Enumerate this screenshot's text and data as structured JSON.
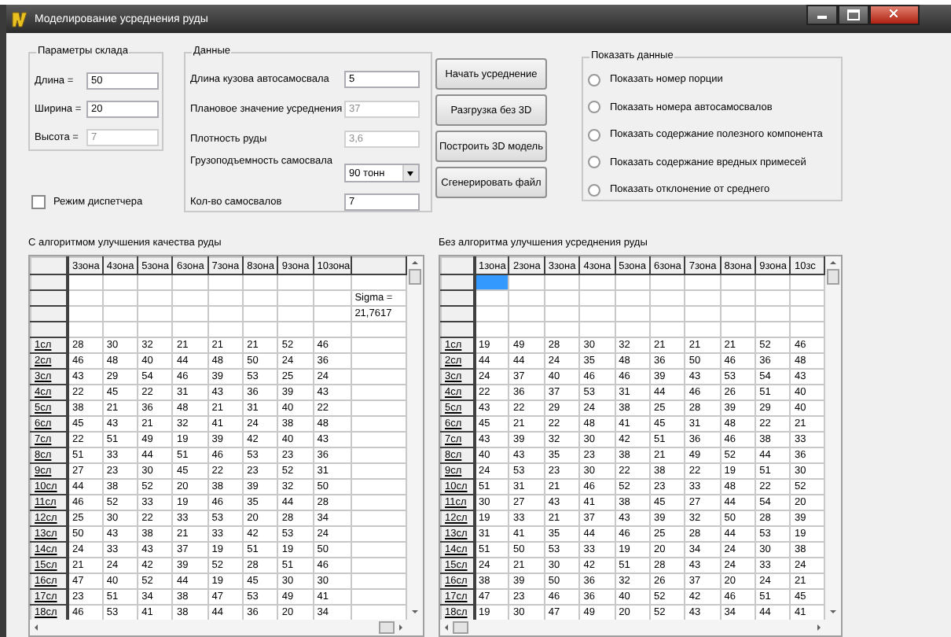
{
  "window": {
    "title": "Моделирование усреднения руды"
  },
  "warehouse": {
    "title": "Параметры склада",
    "fields": [
      {
        "label": "Длина =",
        "value": "50",
        "disabled": false
      },
      {
        "label": "Ширина =",
        "value": "20",
        "disabled": false
      },
      {
        "label": "Высота =",
        "value": "7",
        "disabled": true
      }
    ]
  },
  "dispatcher": {
    "label": "Режим диспетчера",
    "checked": false
  },
  "data": {
    "title": "Данные",
    "fields": [
      {
        "kind": "input",
        "label": "Длина кузова автосамосвала",
        "value": "5",
        "disabled": false
      },
      {
        "kind": "input",
        "label": "Плановое значение усреднения",
        "value": "37",
        "disabled": true
      },
      {
        "kind": "input",
        "label": "Плотность руды",
        "value": "3,6",
        "disabled": true
      },
      {
        "kind": "dropdown",
        "label": "Грузоподъемность самосвала",
        "value": "90 тонн"
      },
      {
        "kind": "input",
        "label": "Кол-во самосвалов",
        "value": "7",
        "disabled": false
      }
    ]
  },
  "buttons": [
    "Начать усреднение",
    "Разгрузка без 3D",
    "Построить 3D модель",
    "Сгенерировать файл"
  ],
  "show_data": {
    "title": "Показать данные",
    "options": [
      {
        "label": "Показать номер порции",
        "selected": false
      },
      {
        "label": "Показать номера автосамосвалов",
        "selected": false
      },
      {
        "label": "Показать содержание полезного компонента",
        "selected": false
      },
      {
        "label": "Показать содержание вредных примесей",
        "selected": false
      },
      {
        "label": "Показать отклонение от среднего",
        "selected": false
      }
    ]
  },
  "tables": [
    {
      "title": "С алгоритмом улучшения качества руды",
      "first_cell_selected": false,
      "columns": [
        "3зона",
        "4зона",
        "5зона",
        "6зона",
        "7зона",
        "8зона",
        "9зона",
        "10зона"
      ],
      "summary": [
        "Sigma =",
        "21,7617"
      ],
      "rows": [
        {
          "header": "1сл",
          "cells": [
            "28",
            "30",
            "32",
            "21",
            "21",
            "21",
            "52",
            "46"
          ]
        },
        {
          "header": "2сл",
          "cells": [
            "46",
            "48",
            "40",
            "44",
            "48",
            "50",
            "24",
            "36"
          ]
        },
        {
          "header": "3сл",
          "cells": [
            "43",
            "29",
            "54",
            "46",
            "39",
            "53",
            "25",
            "24"
          ]
        },
        {
          "header": "4сл",
          "cells": [
            "22",
            "45",
            "22",
            "31",
            "43",
            "36",
            "39",
            "43"
          ]
        },
        {
          "header": "5сл",
          "cells": [
            "38",
            "21",
            "36",
            "48",
            "21",
            "31",
            "40",
            "22"
          ]
        },
        {
          "header": "6сл",
          "cells": [
            "45",
            "43",
            "21",
            "32",
            "41",
            "24",
            "38",
            "48"
          ]
        },
        {
          "header": "7сл",
          "cells": [
            "22",
            "51",
            "49",
            "19",
            "39",
            "42",
            "40",
            "43"
          ]
        },
        {
          "header": "8сл",
          "cells": [
            "51",
            "33",
            "44",
            "51",
            "46",
            "53",
            "23",
            "36"
          ]
        },
        {
          "header": "9сл",
          "cells": [
            "27",
            "23",
            "30",
            "45",
            "22",
            "23",
            "52",
            "31"
          ]
        },
        {
          "header": "10сл",
          "cells": [
            "44",
            "38",
            "52",
            "20",
            "38",
            "39",
            "32",
            "50"
          ]
        },
        {
          "header": "11сл",
          "cells": [
            "46",
            "52",
            "33",
            "19",
            "46",
            "35",
            "44",
            "28"
          ]
        },
        {
          "header": "12сл",
          "cells": [
            "25",
            "30",
            "22",
            "33",
            "53",
            "20",
            "28",
            "34"
          ]
        },
        {
          "header": "13сл",
          "cells": [
            "50",
            "43",
            "38",
            "21",
            "33",
            "42",
            "53",
            "24"
          ]
        },
        {
          "header": "14сл",
          "cells": [
            "24",
            "33",
            "43",
            "37",
            "19",
            "51",
            "19",
            "50"
          ]
        },
        {
          "header": "15сл",
          "cells": [
            "21",
            "24",
            "42",
            "39",
            "52",
            "28",
            "51",
            "46"
          ]
        },
        {
          "header": "16сл",
          "cells": [
            "47",
            "40",
            "52",
            "44",
            "19",
            "45",
            "30",
            "30"
          ]
        },
        {
          "header": "17сл",
          "cells": [
            "23",
            "51",
            "34",
            "38",
            "47",
            "53",
            "49",
            "41"
          ]
        },
        {
          "header": "18сл",
          "cells": [
            "46",
            "53",
            "41",
            "38",
            "44",
            "36",
            "20",
            "34"
          ]
        }
      ]
    },
    {
      "title": "Без алгоритма улучшения усреднения руды",
      "first_cell_selected": true,
      "columns": [
        "1зона",
        "2зона",
        "3зона",
        "4зона",
        "5зона",
        "6зона",
        "7зона",
        "8зона",
        "9зона",
        "10зс"
      ],
      "rows": [
        {
          "header": "1сл",
          "cells": [
            "19",
            "49",
            "28",
            "30",
            "32",
            "21",
            "21",
            "21",
            "52",
            "46"
          ]
        },
        {
          "header": "2сл",
          "cells": [
            "44",
            "44",
            "24",
            "35",
            "48",
            "36",
            "50",
            "46",
            "36",
            "48"
          ]
        },
        {
          "header": "3сл",
          "cells": [
            "24",
            "37",
            "40",
            "46",
            "46",
            "39",
            "43",
            "53",
            "54",
            "43"
          ]
        },
        {
          "header": "4сл",
          "cells": [
            "22",
            "36",
            "37",
            "53",
            "31",
            "44",
            "46",
            "26",
            "51",
            "40"
          ]
        },
        {
          "header": "5сл",
          "cells": [
            "43",
            "22",
            "29",
            "24",
            "38",
            "25",
            "28",
            "39",
            "29",
            "40"
          ]
        },
        {
          "header": "6сл",
          "cells": [
            "45",
            "21",
            "22",
            "48",
            "41",
            "45",
            "31",
            "48",
            "22",
            "21"
          ]
        },
        {
          "header": "7сл",
          "cells": [
            "43",
            "39",
            "32",
            "30",
            "42",
            "51",
            "36",
            "46",
            "38",
            "33"
          ]
        },
        {
          "header": "8сл",
          "cells": [
            "40",
            "43",
            "35",
            "23",
            "38",
            "21",
            "49",
            "52",
            "44",
            "36"
          ]
        },
        {
          "header": "9сл",
          "cells": [
            "24",
            "53",
            "23",
            "30",
            "22",
            "38",
            "22",
            "19",
            "51",
            "30"
          ]
        },
        {
          "header": "10сл",
          "cells": [
            "51",
            "31",
            "21",
            "46",
            "52",
            "23",
            "33",
            "48",
            "22",
            "52"
          ]
        },
        {
          "header": "11сл",
          "cells": [
            "30",
            "27",
            "43",
            "41",
            "38",
            "45",
            "27",
            "44",
            "54",
            "20"
          ]
        },
        {
          "header": "12сл",
          "cells": [
            "19",
            "33",
            "21",
            "37",
            "43",
            "39",
            "32",
            "50",
            "28",
            "39"
          ]
        },
        {
          "header": "13сл",
          "cells": [
            "31",
            "41",
            "35",
            "44",
            "46",
            "25",
            "28",
            "44",
            "53",
            "19"
          ]
        },
        {
          "header": "14сл",
          "cells": [
            "51",
            "50",
            "53",
            "33",
            "19",
            "20",
            "34",
            "24",
            "30",
            "38"
          ]
        },
        {
          "header": "15сл",
          "cells": [
            "24",
            "21",
            "30",
            "42",
            "51",
            "28",
            "43",
            "24",
            "33",
            "24"
          ]
        },
        {
          "header": "16сл",
          "cells": [
            "38",
            "39",
            "50",
            "36",
            "32",
            "26",
            "37",
            "20",
            "24",
            "21"
          ]
        },
        {
          "header": "17сл",
          "cells": [
            "47",
            "23",
            "46",
            "36",
            "40",
            "52",
            "42",
            "46",
            "51",
            "45"
          ]
        },
        {
          "header": "18сл",
          "cells": [
            "19",
            "30",
            "47",
            "49",
            "20",
            "52",
            "43",
            "34",
            "44",
            "41"
          ]
        }
      ]
    }
  ]
}
